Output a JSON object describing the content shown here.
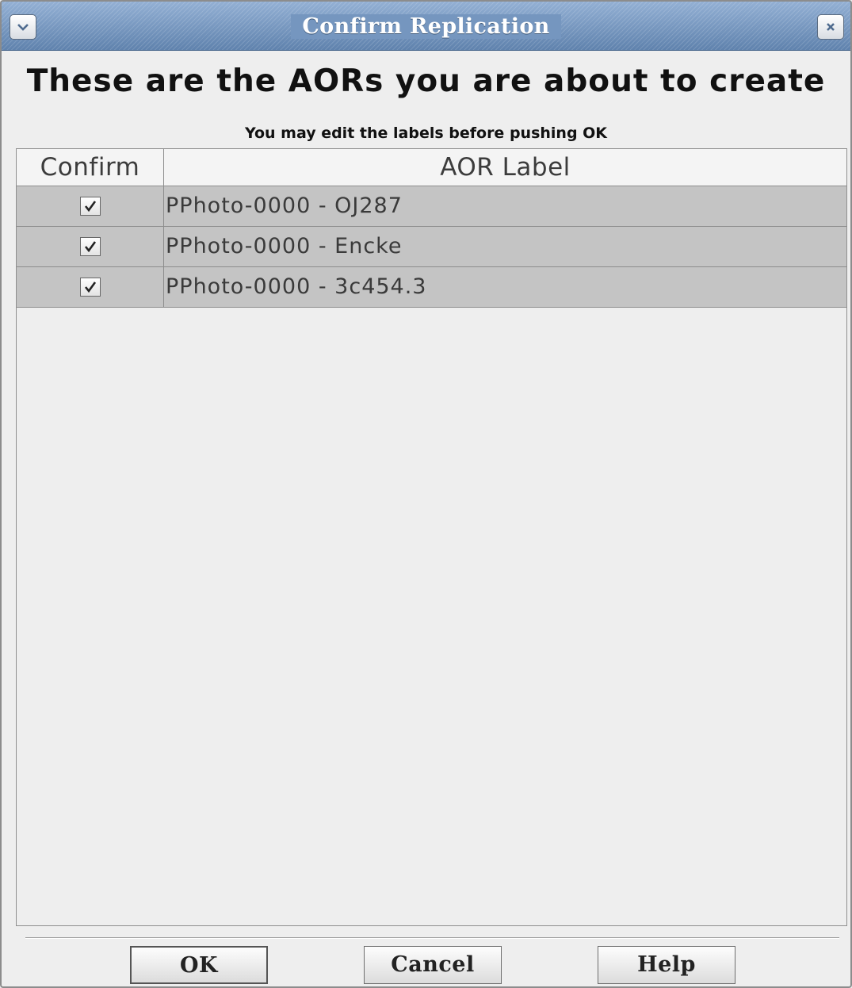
{
  "window": {
    "title": "Confirm Replication",
    "menu_icon": "chevron-down-icon",
    "close_icon": "close-icon"
  },
  "heading": "These are the AORs you are about to create",
  "subheading": "You may edit the labels before pushing OK",
  "table": {
    "columns": [
      "Confirm",
      "AOR Label"
    ],
    "rows": [
      {
        "confirmed": true,
        "label": "PPhoto-0000 - OJ287"
      },
      {
        "confirmed": true,
        "label": "PPhoto-0000 - Encke"
      },
      {
        "confirmed": true,
        "label": "PPhoto-0000 - 3c454.3"
      }
    ]
  },
  "buttons": {
    "ok": "OK",
    "cancel": "Cancel",
    "help": "Help"
  },
  "colors": {
    "titlebar": "#6e8fb8",
    "row_background": "#c4c4c4",
    "window_background": "#eeeeee"
  }
}
